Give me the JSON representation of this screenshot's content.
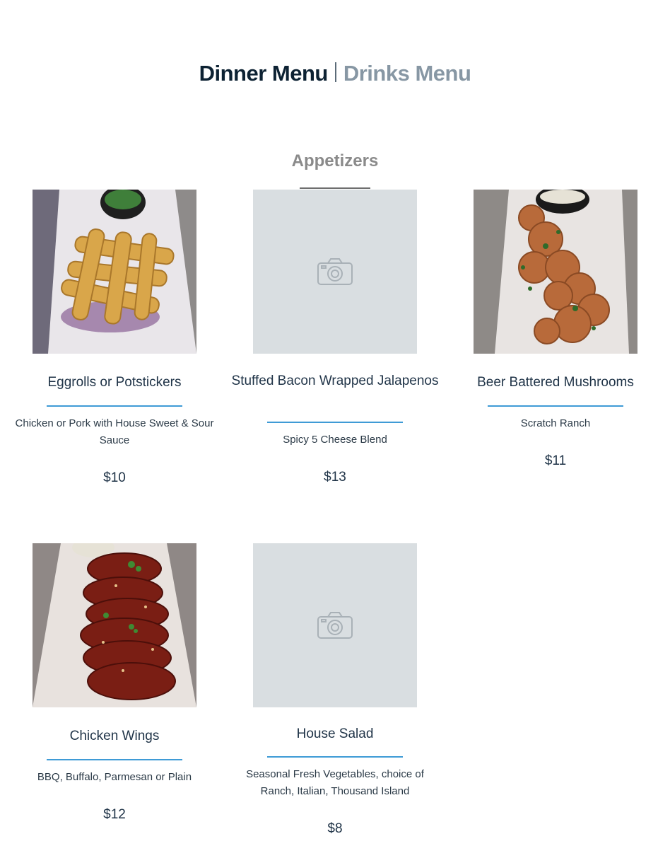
{
  "nav": {
    "dinner_label": "Dinner Menu",
    "drinks_label": "Drinks Menu"
  },
  "section": {
    "title": "Appetizers"
  },
  "colors": {
    "accent_rule": "#3f9bd6",
    "active_tab": "#0d2233",
    "inactive_tab": "#8797a4",
    "placeholder_bg": "#d9dee1"
  },
  "items": [
    {
      "name": "Eggrolls or Potstickers",
      "description": "Chicken or Pork with House Sweet & Sour Sauce",
      "price": "$10",
      "image": "eggrolls-photo"
    },
    {
      "name": "Stuffed Bacon Wrapped Jalapenos",
      "description": "Spicy 5 Cheese Blend",
      "price": "$13",
      "image": "camera-placeholder-icon"
    },
    {
      "name": "Beer Battered Mushrooms",
      "description": "Scratch Ranch",
      "price": "$11",
      "image": "mushrooms-photo"
    },
    {
      "name": "Chicken Wings",
      "description": "BBQ, Buffalo, Parmesan or Plain",
      "price": "$12",
      "image": "wings-photo"
    },
    {
      "name": "House Salad",
      "description": "Seasonal Fresh Vegetables, choice of Ranch, Italian, Thousand Island",
      "price": "$8",
      "image": "camera-placeholder-icon"
    }
  ]
}
